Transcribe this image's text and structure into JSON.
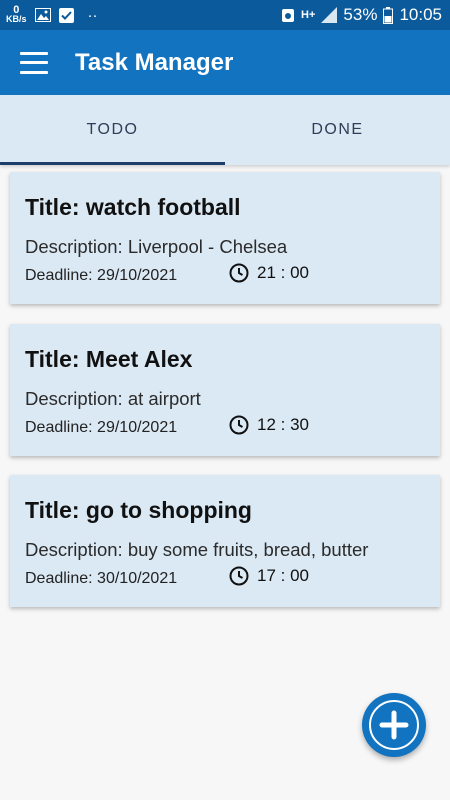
{
  "status_bar": {
    "kbs_value": "0",
    "kbs_unit": "KB/s",
    "dots": "··",
    "network": "H+",
    "battery": "53%",
    "time": "10:05"
  },
  "app_bar": {
    "title": "Task Manager",
    "menu_icon": "hamburger-menu-icon"
  },
  "tabs": [
    {
      "label": "TODO",
      "active": true
    },
    {
      "label": "DONE",
      "active": false
    }
  ],
  "tasks": [
    {
      "title": "Title: watch football",
      "description": "Description: Liverpool - Chelsea",
      "deadline": "Deadline: 29/10/2021",
      "time": "21 : 00"
    },
    {
      "title": "Title: Meet Alex",
      "description": "Description: at airport",
      "deadline": "Deadline: 29/10/2021",
      "time": "12 : 30"
    },
    {
      "title": "Title: go to shopping",
      "description": "Description: buy some fruits, bread, butter",
      "deadline": "Deadline: 30/10/2021",
      "time": "17 : 00"
    }
  ],
  "fab": {
    "icon": "plus-icon"
  },
  "colors": {
    "status_bar": "#0a5a9c",
    "app_bar": "#1273c0",
    "card_bg": "#dbe9f4",
    "tab_indicator": "#1d3d6b"
  }
}
